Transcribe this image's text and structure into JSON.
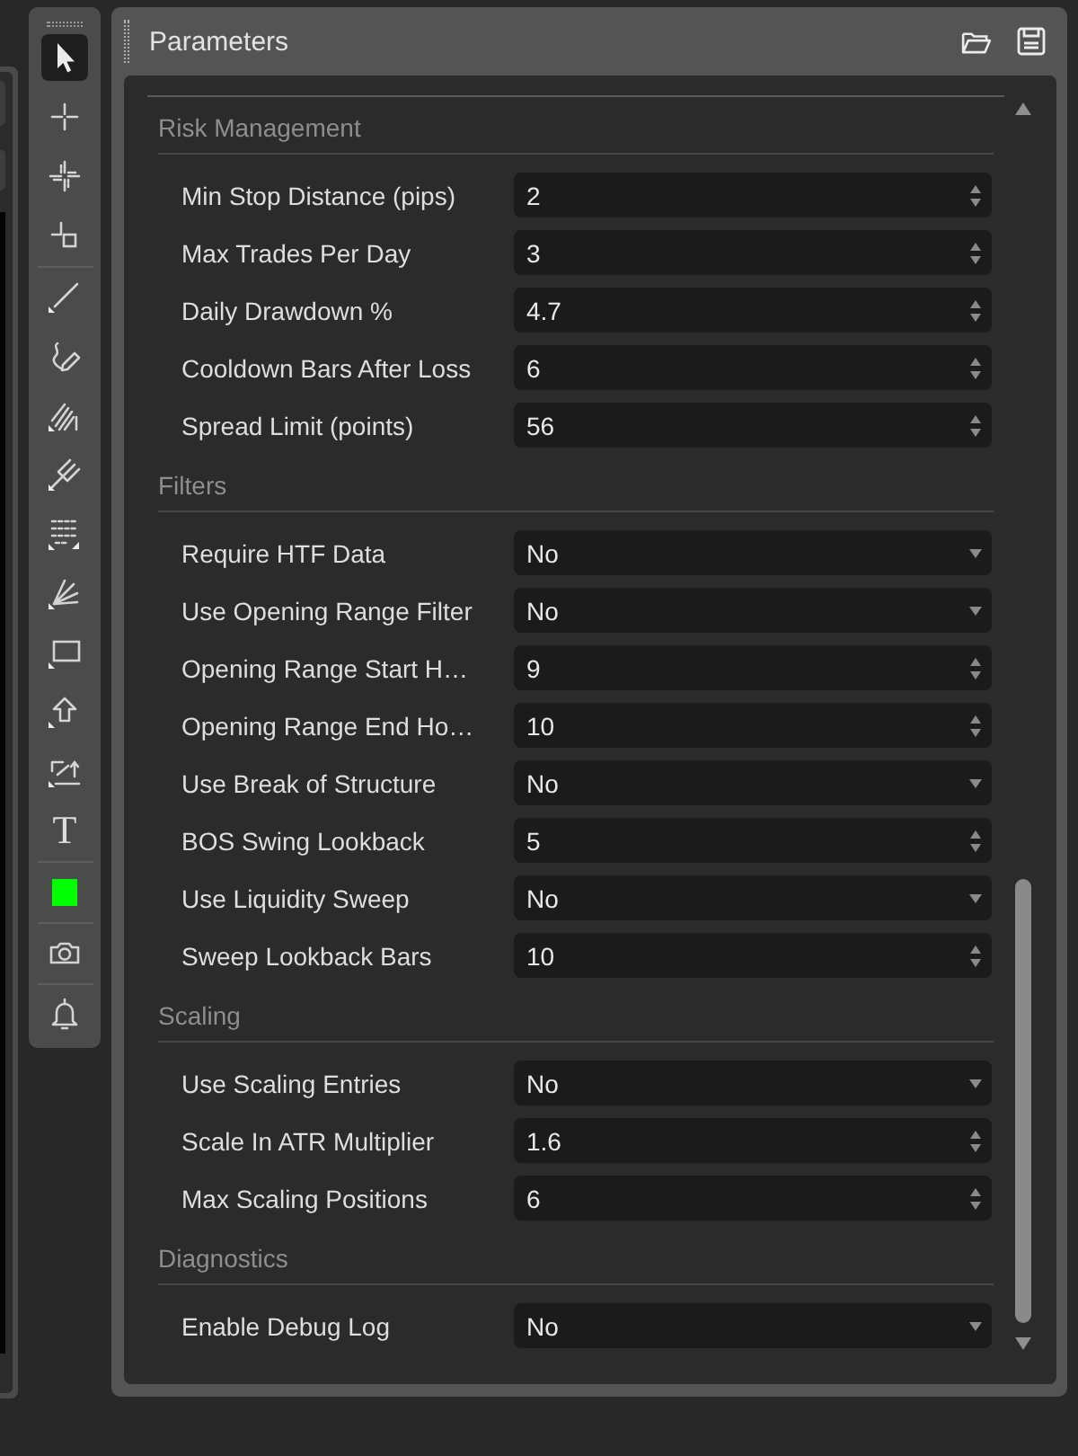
{
  "toolbar": {
    "items": [
      {
        "kind": "tool",
        "selected": true
      },
      {
        "kind": "tool",
        "selected": false
      },
      {
        "kind": "tool",
        "selected": false
      },
      {
        "kind": "tool",
        "selected": false
      },
      {
        "kind": "divider"
      },
      {
        "kind": "tool",
        "selected": false
      },
      {
        "kind": "tool",
        "selected": false
      },
      {
        "kind": "tool",
        "selected": false
      },
      {
        "kind": "tool",
        "selected": false
      },
      {
        "kind": "tool",
        "selected": false
      },
      {
        "kind": "tool",
        "selected": false
      },
      {
        "kind": "tool",
        "selected": false
      },
      {
        "kind": "tool",
        "selected": false
      },
      {
        "kind": "tool",
        "selected": false
      },
      {
        "kind": "text_tool",
        "glyph": "T",
        "selected": false
      },
      {
        "kind": "divider"
      },
      {
        "kind": "swatch",
        "color": "#00ff00"
      },
      {
        "kind": "divider"
      },
      {
        "kind": "tool",
        "selected": false
      },
      {
        "kind": "divider"
      },
      {
        "kind": "tool",
        "selected": false
      }
    ]
  },
  "panel": {
    "title": "Parameters",
    "sections": [
      {
        "title": "Risk Management",
        "params": [
          {
            "label": "Min Stop Distance (pips)",
            "kind": "number",
            "value": "2"
          },
          {
            "label": "Max Trades Per Day",
            "kind": "number",
            "value": "3"
          },
          {
            "label": "Daily Drawdown %",
            "kind": "number",
            "value": "4.7"
          },
          {
            "label": "Cooldown Bars After Loss",
            "kind": "number",
            "value": "6"
          },
          {
            "label": "Spread Limit (points)",
            "kind": "number",
            "value": "56"
          }
        ]
      },
      {
        "title": "Filters",
        "params": [
          {
            "label": "Require HTF Data",
            "kind": "choice",
            "value": "No"
          },
          {
            "label": "Use Opening Range Filter",
            "kind": "choice",
            "value": "No"
          },
          {
            "label": "Opening Range Start H…",
            "kind": "number",
            "value": "9"
          },
          {
            "label": "Opening Range End Ho…",
            "kind": "number",
            "value": "10"
          },
          {
            "label": "Use Break of Structure",
            "kind": "choice",
            "value": "No"
          },
          {
            "label": "BOS Swing Lookback",
            "kind": "number",
            "value": "5"
          },
          {
            "label": "Use Liquidity Sweep",
            "kind": "choice",
            "value": "No"
          },
          {
            "label": "Sweep Lookback Bars",
            "kind": "number",
            "value": "10"
          }
        ]
      },
      {
        "title": "Scaling",
        "params": [
          {
            "label": "Use Scaling Entries",
            "kind": "choice",
            "value": "No"
          },
          {
            "label": "Scale In ATR Multiplier",
            "kind": "number",
            "value": "1.6"
          },
          {
            "label": "Max Scaling Positions",
            "kind": "number",
            "value": "6"
          }
        ]
      },
      {
        "title": "Diagnostics",
        "params": [
          {
            "label": "Enable Debug Log",
            "kind": "choice",
            "value": "No"
          }
        ]
      }
    ]
  }
}
